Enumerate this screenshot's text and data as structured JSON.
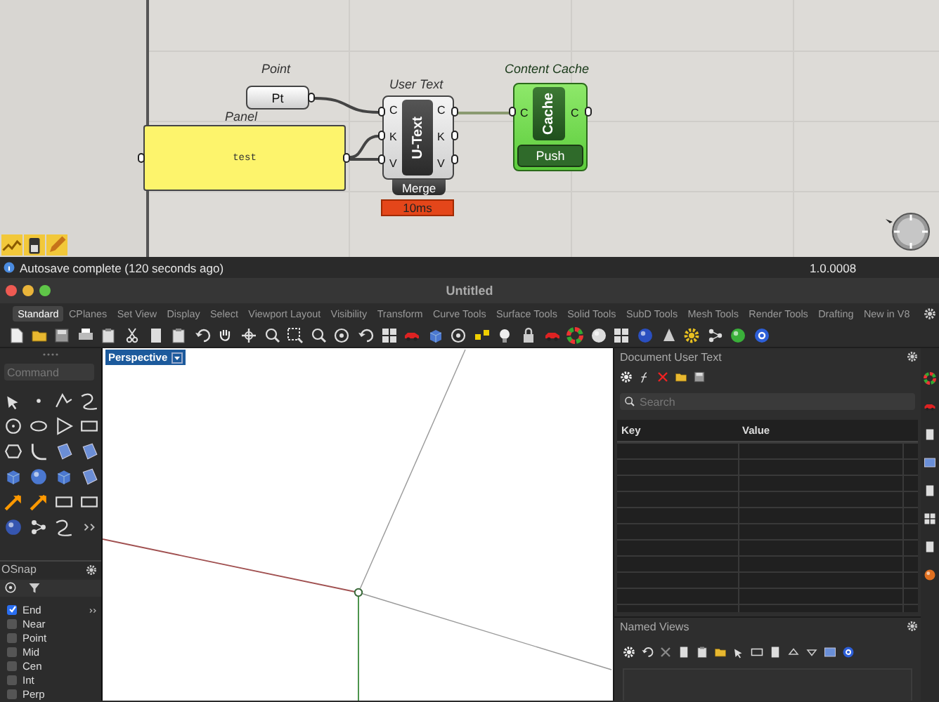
{
  "canvas": {
    "point": {
      "title": "Point",
      "label": "Pt"
    },
    "panel": {
      "title": "Panel",
      "text": "test"
    },
    "user_text": {
      "title": "User Text",
      "name": "U-Text",
      "inputs": [
        "C",
        "K",
        "V"
      ],
      "outputs": [
        "C",
        "K",
        "V"
      ],
      "mode": "Merge",
      "timing": "10ms"
    },
    "cache": {
      "title": "Content Cache",
      "name": "Cache",
      "inputs": [
        "C"
      ],
      "outputs": [
        "C"
      ],
      "button": "Push"
    }
  },
  "status_bar": {
    "message": "Autosave complete (120 seconds ago)",
    "version": "1.0.0008"
  },
  "window": {
    "title": "Untitled"
  },
  "tabs": [
    {
      "label": "Standard",
      "selected": true
    },
    {
      "label": "CPlanes",
      "selected": false
    },
    {
      "label": "Set View",
      "selected": false
    },
    {
      "label": "Display",
      "selected": false
    },
    {
      "label": "Select",
      "selected": false
    },
    {
      "label": "Viewport Layout",
      "selected": false
    },
    {
      "label": "Visibility",
      "selected": false
    },
    {
      "label": "Transform",
      "selected": false
    },
    {
      "label": "Curve Tools",
      "selected": false
    },
    {
      "label": "Surface Tools",
      "selected": false
    },
    {
      "label": "Solid Tools",
      "selected": false
    },
    {
      "label": "SubD Tools",
      "selected": false
    },
    {
      "label": "Mesh Tools",
      "selected": false
    },
    {
      "label": "Render Tools",
      "selected": false
    },
    {
      "label": "Drafting",
      "selected": false
    },
    {
      "label": "New in V8",
      "selected": false
    }
  ],
  "command": {
    "placeholder": "Command"
  },
  "viewport": {
    "label": "Perspective"
  },
  "osnap": {
    "title": "OSnap",
    "items": [
      {
        "label": "End",
        "checked": true
      },
      {
        "label": "Near",
        "checked": false
      },
      {
        "label": "Point",
        "checked": false
      },
      {
        "label": "Mid",
        "checked": false
      },
      {
        "label": "Cen",
        "checked": false
      },
      {
        "label": "Int",
        "checked": false
      },
      {
        "label": "Perp",
        "checked": false
      }
    ]
  },
  "user_text_panel": {
    "title": "Document User Text",
    "search": {
      "placeholder": "Search"
    },
    "columns": [
      "Key",
      "Value"
    ]
  },
  "named_views": {
    "title": "Named Views"
  }
}
